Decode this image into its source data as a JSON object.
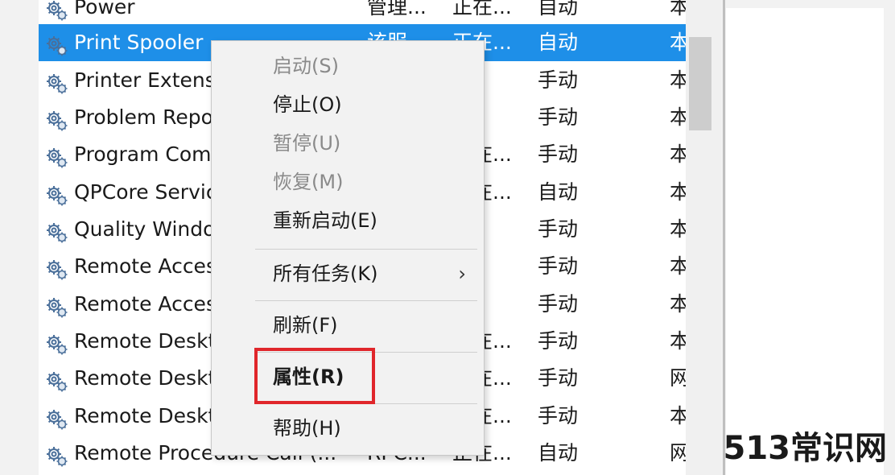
{
  "services": [
    {
      "name": "Power",
      "desc": "管理...",
      "status": "正在...",
      "startup": "自动",
      "logon": "本"
    },
    {
      "name": "Print Spooler",
      "desc": "该服...",
      "status": "正在...",
      "startup": "自动",
      "logon": "本",
      "selected": true
    },
    {
      "name": "Printer Extensions and Notifications",
      "desc": "",
      "status": "",
      "startup": "手动",
      "logon": "本"
    },
    {
      "name": "Problem Reports Control Panel Support",
      "desc": "",
      "status": "",
      "startup": "手动",
      "logon": "本"
    },
    {
      "name": "Program Compatibility Assistant Service",
      "desc": "",
      "status": "正在...",
      "startup": "手动",
      "logon": "本"
    },
    {
      "name": "QPCore Service",
      "desc": "",
      "status": "正在...",
      "startup": "自动",
      "logon": "本"
    },
    {
      "name": "Quality Windows Audio Video Experience",
      "desc": "",
      "status": "",
      "startup": "手动",
      "logon": "本"
    },
    {
      "name": "Remote Access Auto Connection Manager",
      "desc": "",
      "status": "",
      "startup": "手动",
      "logon": "本"
    },
    {
      "name": "Remote Access Connection Manager",
      "desc": "",
      "status": "",
      "startup": "手动",
      "logon": "本"
    },
    {
      "name": "Remote Desktop Configuration",
      "desc": "",
      "status": "正在...",
      "startup": "手动",
      "logon": "本"
    },
    {
      "name": "Remote Desktop Services",
      "desc": "",
      "status": "正在...",
      "startup": "手动",
      "logon": "网"
    },
    {
      "name": "Remote Desktop Services UserMode Port Redirector",
      "desc": "",
      "status": "正在...",
      "startup": "手动",
      "logon": "本"
    },
    {
      "name": "Remote Procedure Call (...",
      "desc": "RPC...",
      "status": "正在...",
      "startup": "自动",
      "logon": "网"
    }
  ],
  "context_menu": {
    "start": "启动(S)",
    "stop": "停止(O)",
    "pause": "暂停(U)",
    "resume": "恢复(M)",
    "restart": "重新启动(E)",
    "all_tasks": "所有任务(K)",
    "submenu_arrow": "›",
    "refresh": "刷新(F)",
    "properties": "属性(R)",
    "help": "帮助(H)"
  },
  "watermark": "513常识网",
  "colors": {
    "selection": "#1e8fe8",
    "highlight_box": "#e0262b"
  },
  "icons": {
    "service": "gear-icon"
  }
}
